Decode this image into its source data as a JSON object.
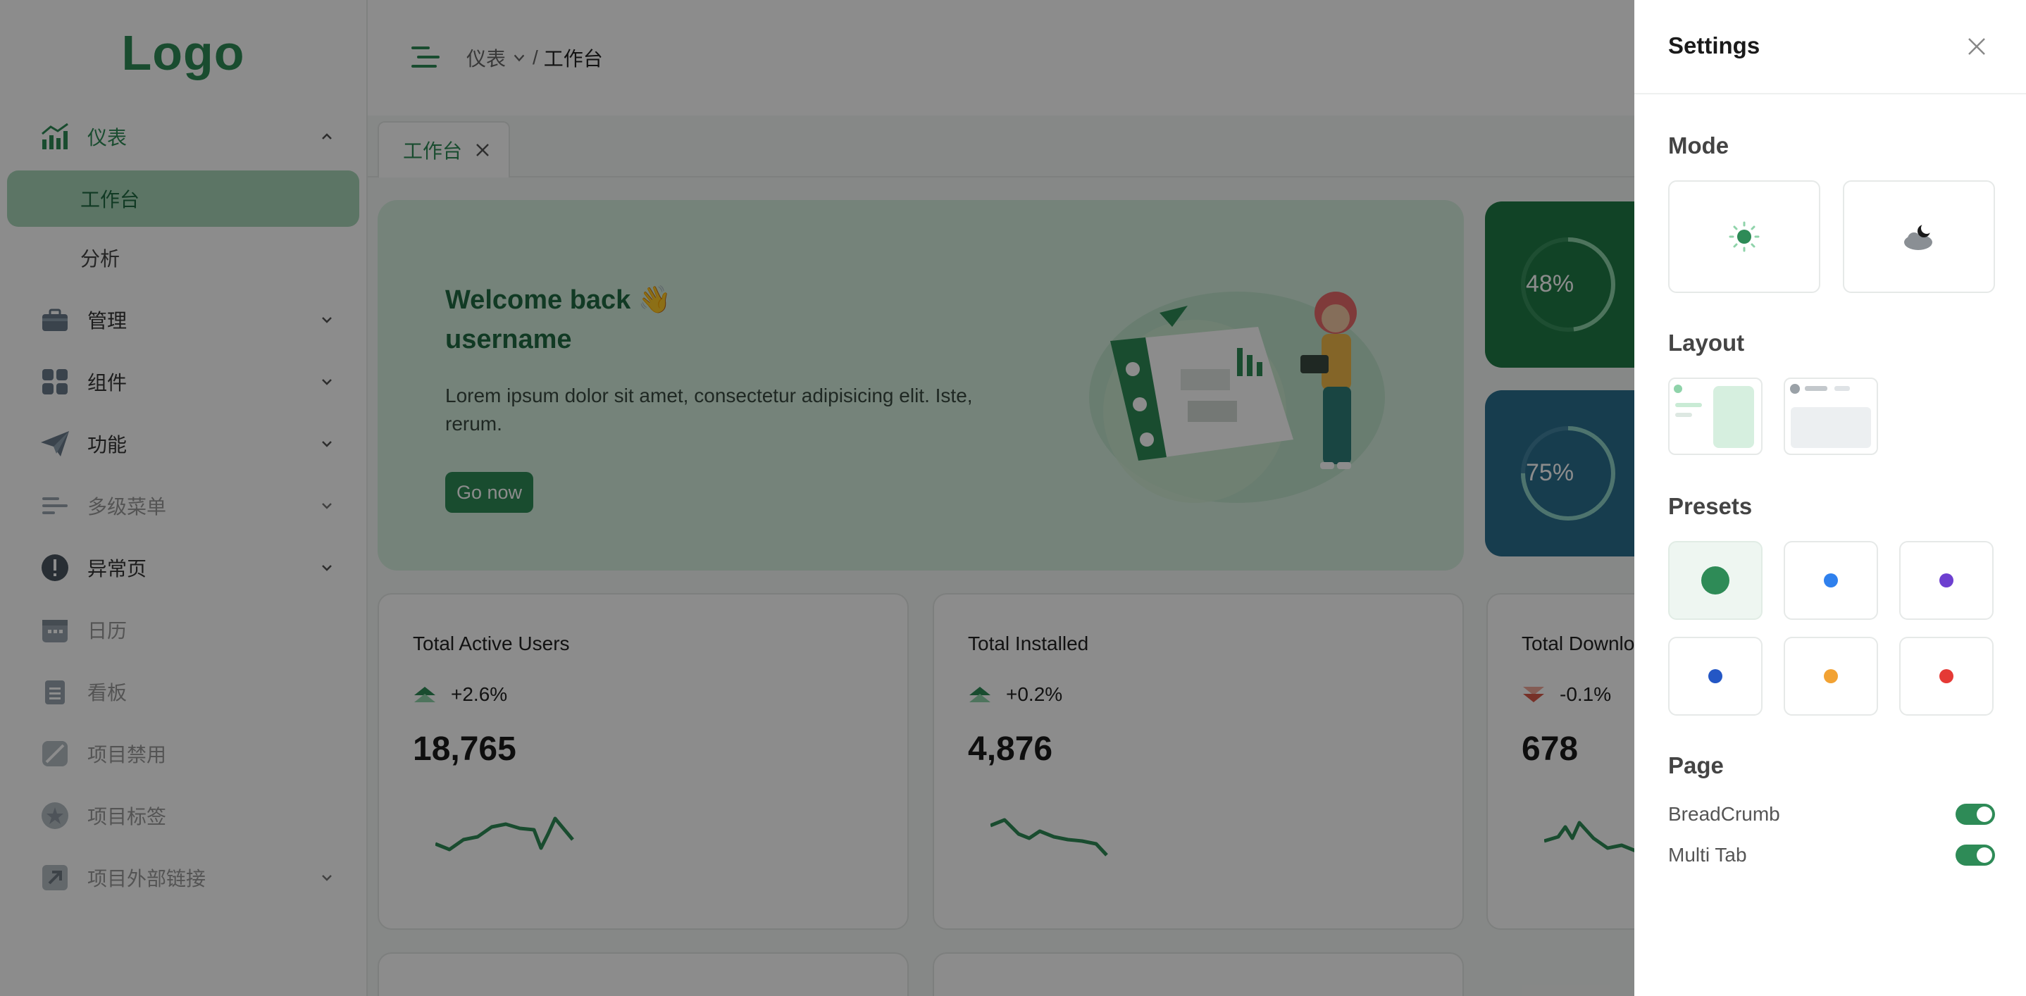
{
  "logo": {
    "text": "Logo"
  },
  "sidebar": {
    "items": [
      {
        "label": "仪表",
        "expanded": true
      },
      {
        "label": "工作台",
        "active": true
      },
      {
        "label": "分析"
      },
      {
        "label": "管理"
      },
      {
        "label": "组件"
      },
      {
        "label": "功能"
      },
      {
        "label": "多级菜单"
      },
      {
        "label": "异常页"
      },
      {
        "label": "日历"
      },
      {
        "label": "看板"
      },
      {
        "label": "项目禁用"
      },
      {
        "label": "项目标签"
      },
      {
        "label": "项目外部链接"
      }
    ]
  },
  "header": {
    "breadcrumb": {
      "parent": "仪表",
      "separator": "/",
      "current": "工作台"
    }
  },
  "tabs": [
    {
      "label": "工作台"
    }
  ],
  "welcome": {
    "title_line1": "Welcome back 👋",
    "title_line2": "username",
    "description": "Lorem ipsum dolor sit amet, consectetur adipisicing elit. Iste, rerum.",
    "button": "Go now"
  },
  "mini_stats": [
    {
      "percent": "48%",
      "percent_value": 48,
      "color": "#1f7a45"
    },
    {
      "percent": "75%",
      "percent_value": 75,
      "color": "#2a6f8f"
    }
  ],
  "metrics": [
    {
      "title": "Total Active Users",
      "change": "+2.6%",
      "trend": "up",
      "value": "18,765"
    },
    {
      "title": "Total Installed",
      "change": "+0.2%",
      "trend": "up",
      "value": "4,876"
    },
    {
      "title": "Total Downlo",
      "change": "-0.1%",
      "trend": "down",
      "value": "678"
    }
  ],
  "settings": {
    "title": "Settings",
    "mode_title": "Mode",
    "layout_title": "Layout",
    "presets_title": "Presets",
    "presets": [
      "#2e8b57",
      "#2f80ed",
      "#6d3fd0",
      "#2457c5",
      "#f2a233",
      "#e53935"
    ],
    "page_title": "Page",
    "toggles": [
      {
        "label": "BreadCrumb",
        "on": true
      },
      {
        "label": "Multi Tab",
        "on": true
      }
    ]
  },
  "colors": {
    "primary": "#2e8b57",
    "welcome_bg": "#d6efdf",
    "overlay": "rgba(0,0,0,0.45)"
  }
}
